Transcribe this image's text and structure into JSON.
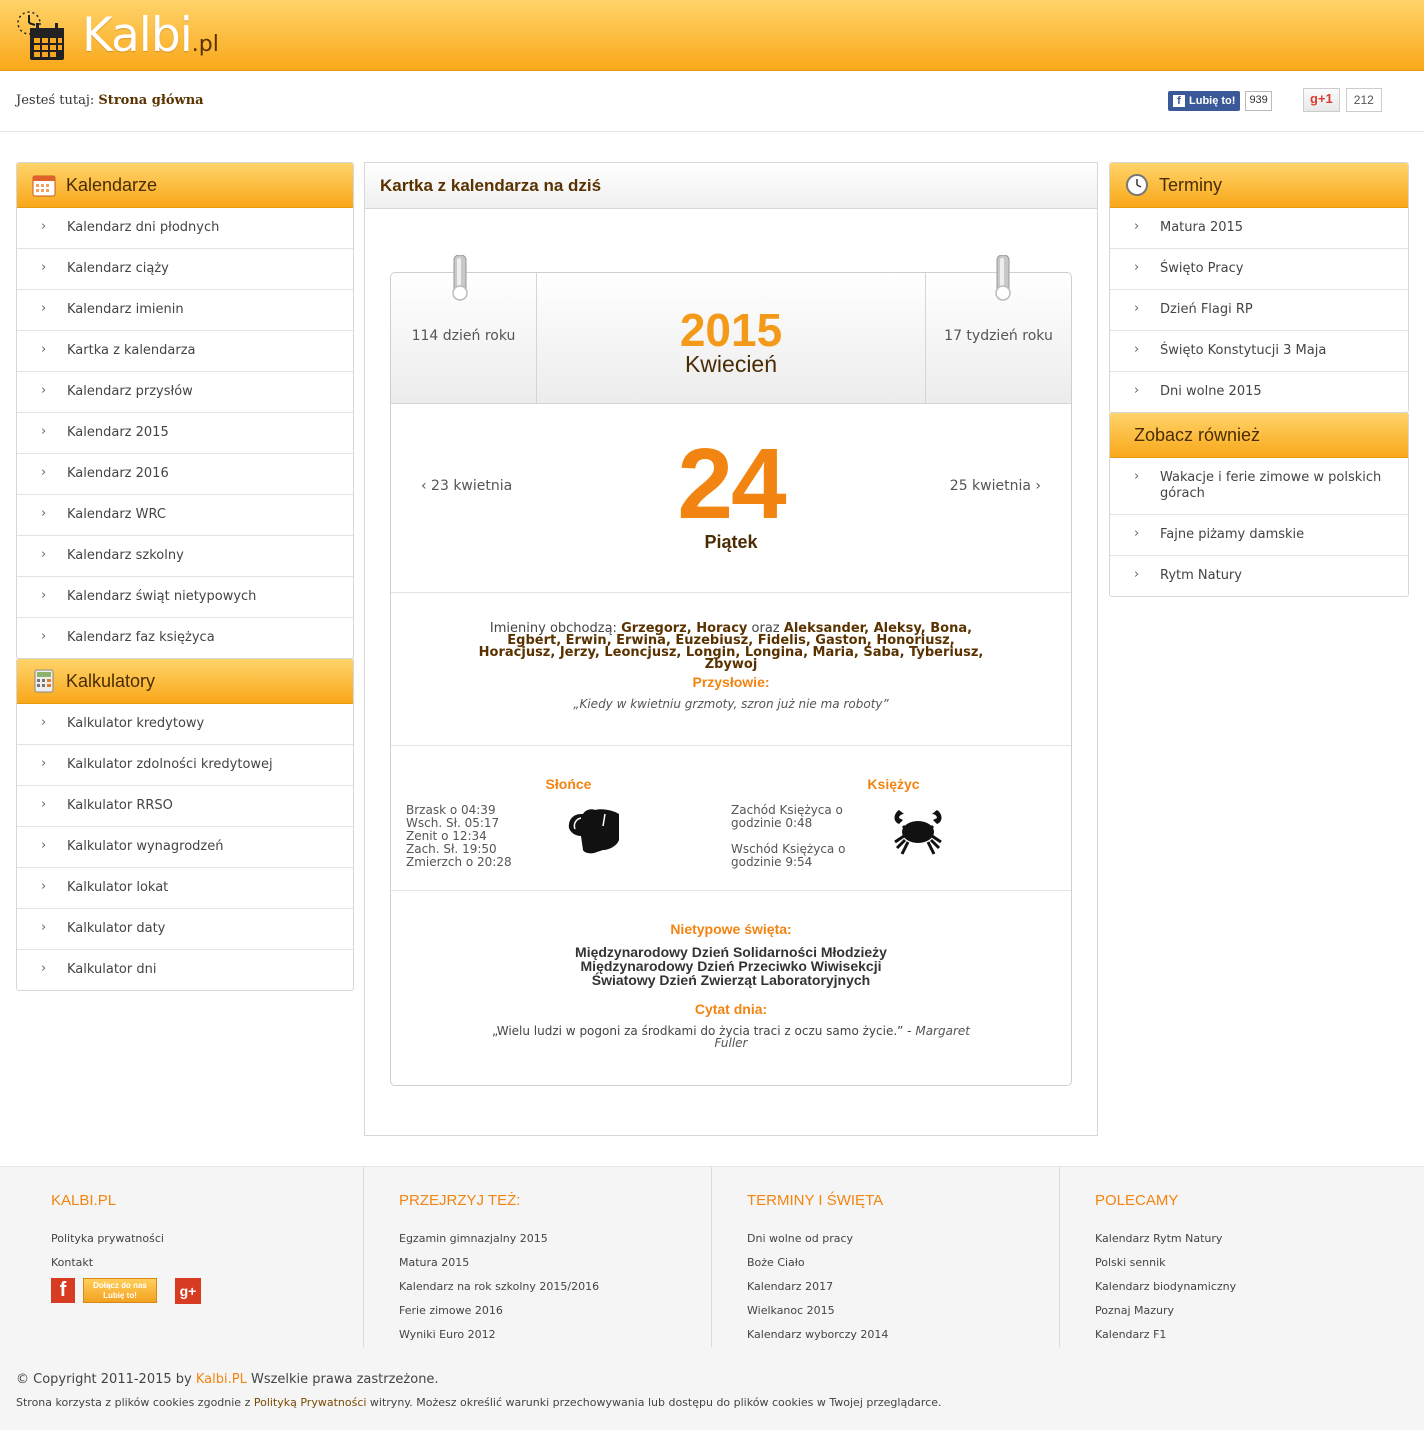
{
  "header": {
    "logo_text": "Kalbi",
    "logo_tld": ".pl"
  },
  "breadcrumb": {
    "label": "Jesteś tutaj:",
    "current": "Strona główna"
  },
  "social": {
    "fb_like_label": "Lubię to!",
    "fb_count": "939",
    "gplus_label": "g+1",
    "gplus_count": "212"
  },
  "sidebar_left": {
    "calendars": {
      "title": "Kalendarze",
      "items": [
        "Kalendarz dni płodnych",
        "Kalendarz ciąży",
        "Kalendarz imienin",
        "Kartka z kalendarza",
        "Kalendarz przysłów",
        "Kalendarz 2015",
        "Kalendarz 2016",
        "Kalendarz WRC",
        "Kalendarz szkolny",
        "Kalendarz świąt nietypowych",
        "Kalendarz faz księżyca"
      ]
    },
    "calculators": {
      "title": "Kalkulatory",
      "items": [
        "Kalkulator kredytowy",
        "Kalkulator zdolności kredytowej",
        "Kalkulator RRSO",
        "Kalkulator wynagrodzeń",
        "Kalkulator lokat",
        "Kalkulator daty",
        "Kalkulator dni"
      ]
    }
  },
  "sidebar_right": {
    "terms": {
      "title": "Terminy",
      "items": [
        "Matura 2015",
        "Święto Pracy",
        "Dzień Flagi RP",
        "Święto Konstytucji 3 Maja",
        "Dni wolne 2015"
      ]
    },
    "see_also": {
      "title": "Zobacz również",
      "items": [
        "Wakacje i ferie zimowe w polskich górach",
        "Fajne piżamy damskie",
        "Rytm Natury"
      ]
    }
  },
  "main": {
    "title": "Kartka z kalendarza na dziś",
    "day_of_year": "114 dzień roku",
    "week_of_year": "17 tydzień roku",
    "year": "2015",
    "month": "Kwiecień",
    "prev_day": "‹ 23 kwietnia",
    "next_day": "25 kwietnia ›",
    "day": "24",
    "weekday": "Piątek",
    "names_label": "Imieniny obchodzą:",
    "names_primary": "Grzegorz, Horacy",
    "names_and": "oraz",
    "names_rest": "Aleksander, Aleksy, Bona, Egbert, Erwin, Erwina, Euzebiusz, Fidelis, Gaston, Honoriusz, Horacjusz, Jerzy, Leoncjusz, Longin, Longina, Maria, Saba, Tyberiusz, Zbywoj",
    "proverb_title": "Przysłowie:",
    "proverb": "„Kiedy w kwietniu grzmoty, szron już nie ma roboty”",
    "sun_title": "Słońce",
    "sun_times": [
      "Brzask o 04:39",
      "Wsch. Sł. 05:17",
      "Zenit o 12:34",
      "Zach. Sł. 19:50",
      "Zmierzch o 20:28"
    ],
    "moon_title": "Księżyc",
    "moon_set": "Zachód Księżyca o godzinie 0:48",
    "moon_rise": "Wschód Księżyca o godzinie 9:54",
    "holidays_title": "Nietypowe święta:",
    "holidays": [
      "Międzynarodowy Dzień Solidarności Młodzieży",
      "Międzynarodowy Dzień Przeciwko Wiwisekcji",
      "Światowy Dzień Zwierząt Laboratoryjnych"
    ],
    "quote_title": "Cytat dnia:",
    "quote": "„Wielu ludzi w pogoni za środkami do życia traci z oczu samo życie.” -",
    "quote_author": "Margaret Fuller"
  },
  "footer": {
    "col1": {
      "title": "KALBI.PL",
      "items": [
        "Polityka prywatności",
        "Kontakt"
      ]
    },
    "col2": {
      "title": "PRZEJRZYJ TEŻ:",
      "items": [
        "Egzamin gimnazjalny 2015",
        "Matura 2015",
        "Kalendarz na rok szkolny 2015/2016",
        "Ferie zimowe 2016",
        "Wyniki Euro 2012"
      ]
    },
    "col3": {
      "title": "TERMINY I ŚWIĘTA",
      "items": [
        "Dni wolne od pracy",
        "Boże Ciało",
        "Kalendarz 2017",
        "Wielkanoc 2015",
        "Kalendarz wyborczy 2014"
      ]
    },
    "col4": {
      "title": "POLECAMY",
      "items": [
        "Kalendarz Rytm Natury",
        "Polski sennik",
        "Kalendarz biodynamiczny",
        "Poznaj Mazury",
        "Kalendarz F1"
      ]
    },
    "join_line1": "Dołącz do nas",
    "join_line2": "Lubię to!",
    "copyright_pre": "© Copyright 2011-2015 by",
    "copyright_brand": "Kalbi.PL",
    "copyright_post": "Wszelkie prawa zastrzeżone.",
    "cookies_pre": "Strona korzysta z plików cookies zgodnie z",
    "cookies_link": "Polityką Prywatności",
    "cookies_post": "witryny. Możesz określić warunki przechowywania lub dostępu do plików cookies w Twojej przeglądarce."
  },
  "icons": {
    "logo": "calendar-clock-icon",
    "calendars": "calendar-icon",
    "calculators": "calculator-icon",
    "terms": "clock-icon",
    "sun_sign": "taurus-icon",
    "moon_sign": "cancer-crab-icon"
  },
  "colors": {
    "accent_orange": "#f28411",
    "header_gradient_top": "#ffd36a",
    "header_gradient_bottom": "#f9a81a",
    "brown_text": "#5a3200"
  }
}
